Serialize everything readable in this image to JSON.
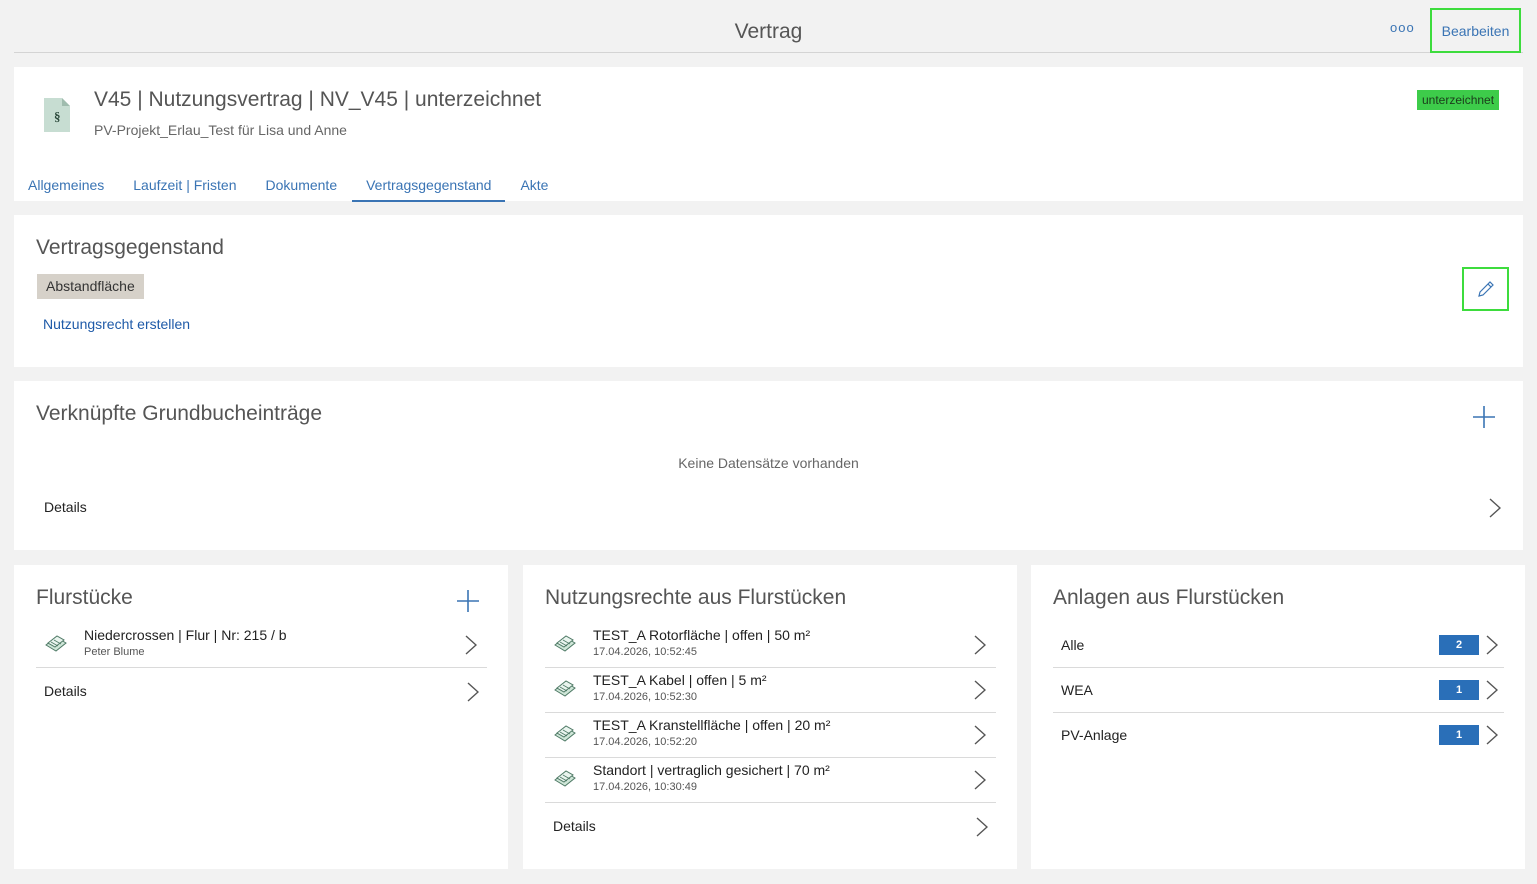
{
  "topbar": {
    "title": "Vertrag",
    "more_label": "ooo",
    "edit_label": "Bearbeiten"
  },
  "header": {
    "title": "V45 | Nutzungsvertrag | NV_V45 | unterzeichnet",
    "subtitle": "PV-Projekt_Erlau_Test für Lisa und Anne",
    "status": "unterzeichnet",
    "icon_glyph": "§",
    "tabs": [
      {
        "label": "Allgemeines"
      },
      {
        "label": "Laufzeit | Fristen"
      },
      {
        "label": "Dokumente"
      },
      {
        "label": "Vertragsgegenstand"
      },
      {
        "label": "Akte"
      }
    ],
    "active_tab": "Vertragsgegenstand"
  },
  "vertragsgegenstand": {
    "title": "Vertragsgegenstand",
    "tag": "Abstandfläche",
    "link": "Nutzungsrecht erstellen"
  },
  "grundbuch": {
    "title": "Verknüpfte Grundbucheinträge",
    "empty_text": "Keine Datensätze vorhanden",
    "details_label": "Details"
  },
  "flurstuecke": {
    "title": "Flurstücke",
    "items": [
      {
        "title": "Niedercrossen | Flur | Nr: 215 / b",
        "subtitle": "Peter Blume"
      }
    ],
    "details_label": "Details"
  },
  "nutzungsrechte": {
    "title": "Nutzungsrechte aus Flurstücken",
    "items": [
      {
        "title": "TEST_A Rotorfläche | offen | 50 m²",
        "subtitle": "17.04.2026, 10:52:45"
      },
      {
        "title": "TEST_A Kabel | offen | 5 m²",
        "subtitle": "17.04.2026, 10:52:30"
      },
      {
        "title": "TEST_A Kranstellfläche | offen | 20 m²",
        "subtitle": "17.04.2026, 10:52:20"
      },
      {
        "title": "Standort | vertraglich gesichert | 70 m²",
        "subtitle": "17.04.2026, 10:30:49"
      }
    ],
    "details_label": "Details"
  },
  "anlagen": {
    "title": "Anlagen aus Flurstücken",
    "items": [
      {
        "label": "Alle",
        "count": "2"
      },
      {
        "label": "WEA",
        "count": "1"
      },
      {
        "label": "PV-Anlage",
        "count": "1"
      }
    ]
  },
  "colors": {
    "accent": "#3a74b4",
    "highlight": "#3ddc3d",
    "status_green": "#3dcc4a",
    "count_badge": "#2a6fb8"
  }
}
